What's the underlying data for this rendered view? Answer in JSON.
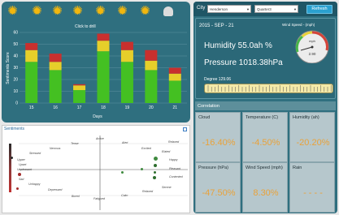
{
  "app": {
    "click_hint": "Click to drill",
    "weather_icons": [
      "sun-icon",
      "sun-icon",
      "sun-icon",
      "sun-icon",
      "sun-icon",
      "sun-icon",
      "sun-icon",
      "cloud-icon"
    ]
  },
  "chart_data": {
    "type": "bar",
    "stacked": true,
    "categories": [
      "15",
      "16",
      "17",
      "18",
      "19",
      "20",
      "21"
    ],
    "series": [
      {
        "name": "",
        "color": "#44c022",
        "values": [
          35,
          28,
          11,
          44,
          35,
          28,
          19
        ]
      },
      {
        "name": "",
        "color": "#e6cf2a",
        "values": [
          10,
          7,
          4,
          9,
          10,
          8,
          6
        ]
      },
      {
        "name": "",
        "color": "#c8302e",
        "values": [
          6,
          7,
          1,
          6,
          7,
          9,
          5
        ]
      }
    ],
    "xlabel": "Days",
    "ylabel": "Sentiments Score",
    "ylim": [
      0,
      60
    ],
    "yticks": [
      "0",
      "10",
      "20",
      "30",
      "40",
      "50",
      "60"
    ],
    "grid": true
  },
  "sentiments": {
    "title": "Sentiments",
    "words": [
      "Active",
      "Alert",
      "Excited",
      "Elated",
      "Relaxed",
      "Tense",
      "Nervous",
      "Stressed",
      "Upset",
      "Unhappy",
      "Sad",
      "Depressed",
      "Bored",
      "Fatigued",
      "Calm",
      "Relaxed",
      "Serene",
      "Contented",
      "Pleasant",
      "Happy",
      "Upper",
      "Unpleasant"
    ],
    "dot_colors": [
      "#2e6e2e",
      "#3f8a3f",
      "#a32b2b",
      "#2b2b2b"
    ]
  },
  "controls": {
    "city_label": "City",
    "city_value": "Henderson",
    "quarter_value": "Quarter3",
    "refresh_label": "Refresh"
  },
  "weather": {
    "date": "2015 - SEP - 21",
    "wind_speed_label": "Wind Speed - (mph)",
    "humidity": "Humidity 55.0ah %",
    "pressure": "Pressure 1018.38hPa",
    "degree": "Degree 129.06",
    "gauge_value": "2.90",
    "gauge_unit": "mph",
    "gauge_fraction": 0.29
  },
  "correlation": {
    "title": "Correlation",
    "cells": [
      {
        "label": "Cloud",
        "value": "-16.40%"
      },
      {
        "label": "Temperature (C)",
        "value": "-4.50%"
      },
      {
        "label": "Humidity (ah)",
        "value": "-20.20%"
      },
      {
        "label": "Pressure (hPa)",
        "value": "-47.50%"
      },
      {
        "label": "Wind Speed (mph)",
        "value": "8.30%"
      },
      {
        "label": "Rain",
        "value": "- - - -"
      }
    ]
  }
}
